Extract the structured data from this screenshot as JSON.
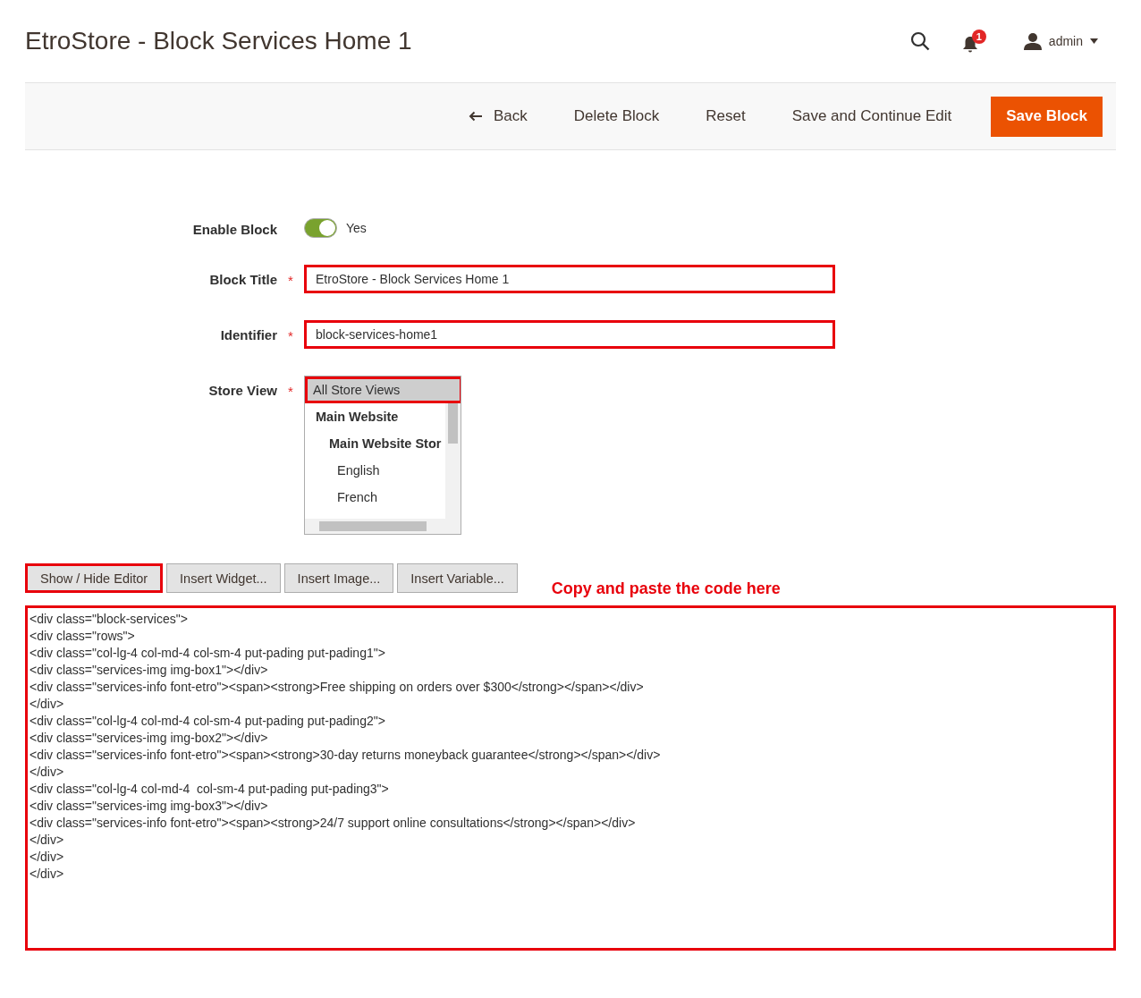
{
  "page_title": "EtroStore - Block Services Home 1",
  "header": {
    "notification_count": "1",
    "user": "admin"
  },
  "actions": [
    {
      "label": "Back",
      "kind": "back"
    },
    {
      "label": "Delete Block",
      "kind": "plain"
    },
    {
      "label": "Reset",
      "kind": "plain"
    },
    {
      "label": "Save and Continue Edit",
      "kind": "plain"
    },
    {
      "label": "Save Block",
      "kind": "primary"
    }
  ],
  "form": {
    "enable_block": {
      "label": "Enable Block",
      "on": true,
      "value": "Yes"
    },
    "block_title": {
      "label": "Block Title",
      "required_mark": "*",
      "value": "EtroStore - Block Services Home 1",
      "highlighted": true
    },
    "identifier": {
      "label": "Identifier",
      "required_mark": "*",
      "value": "block-services-home1",
      "highlighted": true
    },
    "store_view": {
      "label": "Store View",
      "required_mark": "*",
      "highlighted": true,
      "options": [
        {
          "label": "All Store Views",
          "kind": "all",
          "selected": true
        },
        {
          "label": "Main Website",
          "kind": "website",
          "selected": false,
          "children": [
            {
              "label": "Main Website Stor",
              "kind": "store",
              "selected": false,
              "children": [
                {
                  "label": "English",
                  "kind": "view",
                  "selected": false
                },
                {
                  "label": "French",
                  "kind": "view",
                  "selected": false
                }
              ]
            }
          ]
        }
      ]
    }
  },
  "editor_buttons": [
    {
      "label": "Show / Hide Editor",
      "highlighted": true
    },
    {
      "label": "Insert Widget...",
      "highlighted": false
    },
    {
      "label": "Insert Image...",
      "highlighted": false
    },
    {
      "label": "Insert Variable...",
      "highlighted": false
    }
  ],
  "annotation": "Copy and paste the code here",
  "content": {
    "highlighted": true,
    "lines": [
      "<div class=\"block-services\">",
      "<div class=\"rows\">",
      "<div class=\"col-lg-4 col-md-4 col-sm-4 put-pading put-pading1\">",
      "<div class=\"services-img img-box1\"></div>",
      "<div class=\"services-info font-etro\"><span><strong>Free shipping on orders over $300</strong></span></div>",
      "</div>",
      "<div class=\"col-lg-4 col-md-4 col-sm-4 put-pading put-pading2\">",
      "<div class=\"services-img img-box2\"></div>",
      "<div class=\"services-info font-etro\"><span><strong>30-day returns moneyback guarantee</strong></span></div>",
      "</div>",
      "<div class=\"col-lg-4 col-md-4  col-sm-4 put-pading put-pading3\">",
      "<div class=\"services-img img-box3\"></div>",
      "<div class=\"services-info font-etro\"><span><strong>24/7 support online consultations</strong></span></div>",
      "</div>",
      "</div>",
      "</div>"
    ]
  }
}
